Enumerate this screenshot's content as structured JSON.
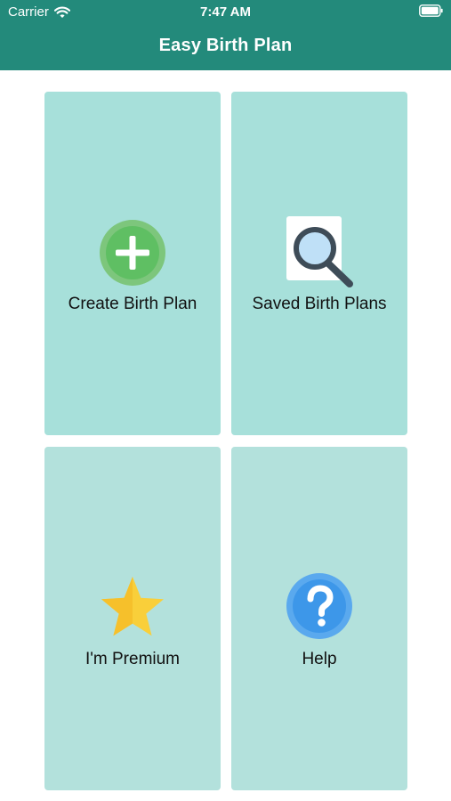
{
  "status_bar": {
    "carrier": "Carrier",
    "time": "7:47 AM",
    "wifi_icon": "wifi-icon",
    "battery_icon": "battery-icon"
  },
  "header": {
    "title": "Easy Birth Plan"
  },
  "menu": {
    "tiles": [
      {
        "label": "Create Birth Plan",
        "icon": "plus-circle-icon"
      },
      {
        "label": "Saved Birth Plans",
        "icon": "magnifier-icon"
      },
      {
        "label": "I'm Premium",
        "icon": "star-icon"
      },
      {
        "label": "Help",
        "icon": "question-circle-icon"
      }
    ]
  },
  "colors": {
    "header_bg": "#238a7b",
    "tile_top_bg": "#a7e0da",
    "tile_bottom_bg": "#b3e1dc",
    "plus_green": "#5fbf63",
    "help_blue": "#3d97e9",
    "star_yellow": "#f9cf3a"
  }
}
